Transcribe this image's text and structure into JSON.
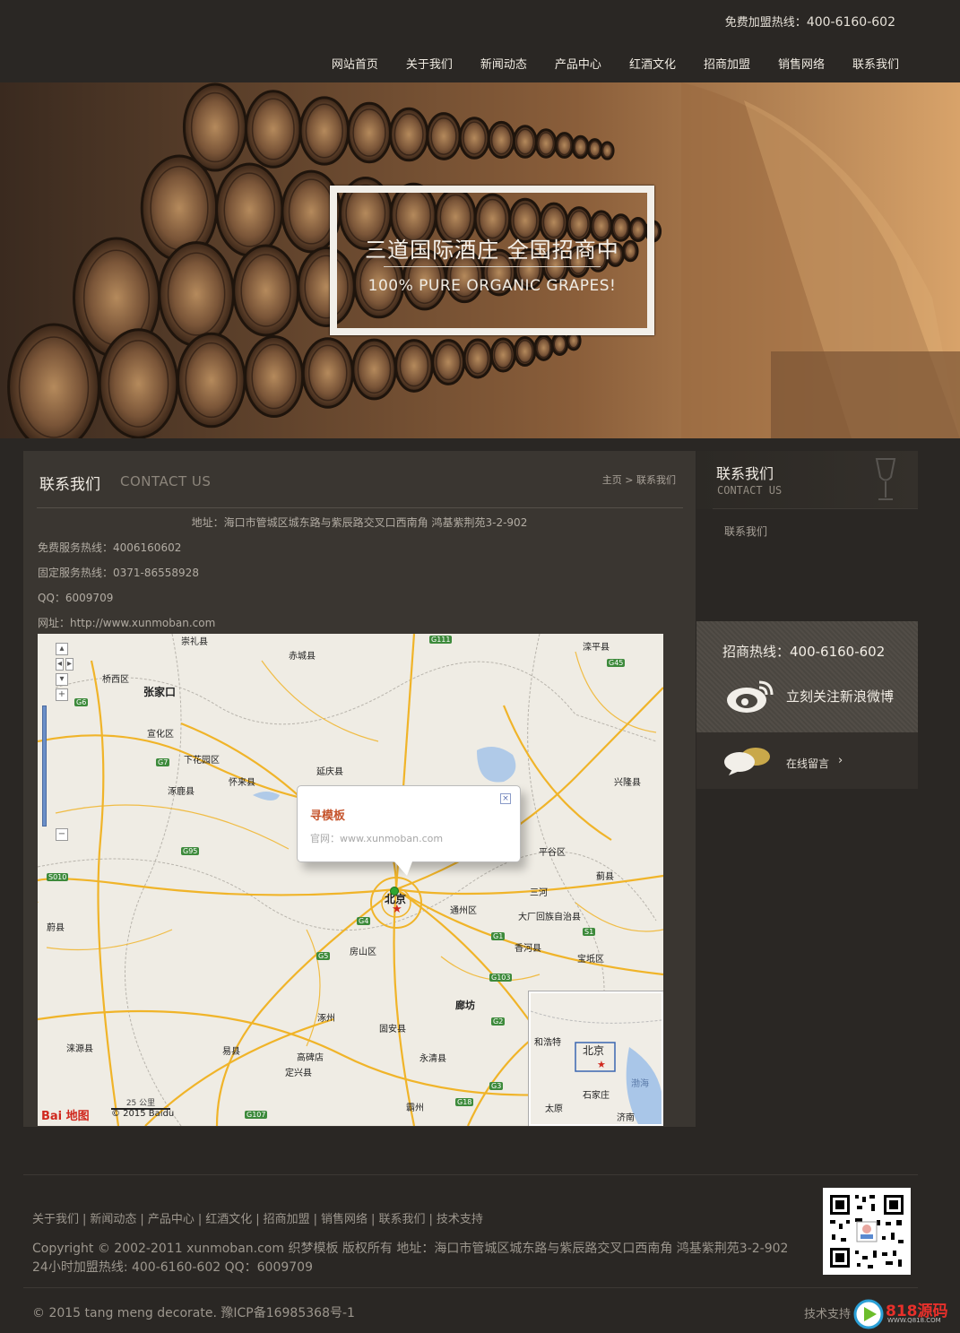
{
  "header": {
    "hotline_label": "免费加盟热线：",
    "hotline_number": "400-6160-602",
    "nav": [
      "网站首页",
      "关于我们",
      "新闻动态",
      "产品中心",
      "红酒文化",
      "招商加盟",
      "销售网络",
      "联系我们"
    ]
  },
  "banner": {
    "title": "三道国际酒庄  全国招商中",
    "subtitle": "100% PURE ORGANIC GRAPES!"
  },
  "main": {
    "title": "联系我们",
    "title_en": "CONTACT US",
    "breadcrumb": "主页 > 联系我们",
    "address": "地址：海口市管城区城东路与紫辰路交叉口西南角  鸿基紫荆苑3-2-902",
    "info": [
      "免费服务热线：4006160602",
      "固定服务热线：0371-86558928",
      "QQ：6009709",
      "网址：http://www.xunmoban.com"
    ]
  },
  "map": {
    "popup_title": "寻模板",
    "popup_url": "官网：www.xunmoban.com",
    "popup_close": "×",
    "zoom_in": "+",
    "zoom_out": "−",
    "labels": [
      "张家口",
      "桥西区",
      "宣化区",
      "下花园区",
      "怀来县",
      "涿鹿县",
      "延庆县",
      "赤城县",
      "滦平县",
      "兴隆县",
      "平谷区",
      "蓟县",
      "北京",
      "三河",
      "通州区",
      "大厂回族自治县",
      "香河县",
      "宝坻区",
      "房山区",
      "廊坊",
      "固安县",
      "永清县",
      "涿州",
      "高碑店",
      "定兴县",
      "易县",
      "涞源县",
      "蔚县",
      "霸州",
      "崇礼县"
    ],
    "roads": [
      "G111",
      "G45",
      "G6",
      "G7",
      "G95",
      "S010",
      "G4",
      "G1",
      "S1",
      "G5",
      "G103",
      "G2",
      "G3",
      "G18",
      "G107"
    ],
    "minimap_labels": [
      "北京",
      "和浩特",
      "石家庄",
      "太原",
      "济南",
      "渤海"
    ],
    "scale": "25 公里",
    "logo": "Bai 地图",
    "copyright": "© 2015 Baidu"
  },
  "sidebar": {
    "title": "联系我们",
    "title_en": "CONTACT US",
    "item": "联系我们",
    "hotline": "招商热线：400-6160-602",
    "weibo": "立刻关注新浪微博",
    "message": "在线留言",
    "message_arrow": "›"
  },
  "footer": {
    "links": [
      "关于我们",
      "新闻动态",
      "产品中心",
      "红酒文化",
      "招商加盟",
      "销售网络",
      "联系我们",
      "技术支持"
    ],
    "copyright_line1": "Copyright © 2002-2011 xunmoban.com 织梦模板 版权所有 地址：海口市管城区城东路与紫辰路交叉口西南角 鸿基紫荆苑3-2-902",
    "copyright_line2": "24小时加盟热线: 400-6160-602 QQ：6009709",
    "bottom": "© 2015 tang meng decorate. 豫ICP备16985368号-1",
    "tech": "技术支持",
    "watermark": "818源码",
    "watermark_url": "WWW.Q818.COM"
  },
  "colors": {
    "background": "#2a2724",
    "panel": "#3a3631",
    "map_road": "#f0b429",
    "accent_red": "#c5542c"
  }
}
